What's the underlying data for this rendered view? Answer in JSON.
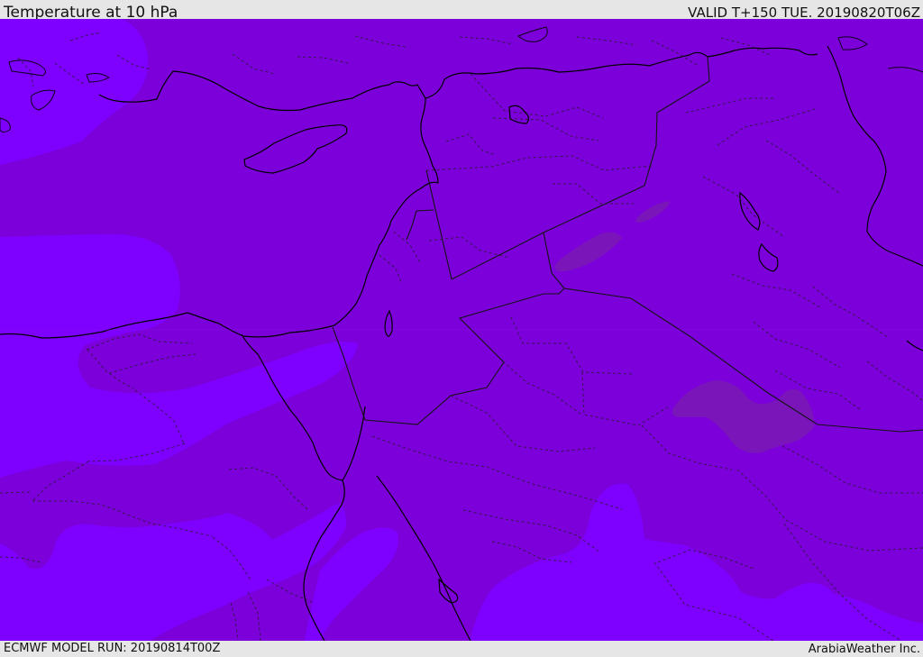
{
  "header": {
    "title": "Temperature at 10 hPa",
    "valid": "VALID T+150 TUE. 20190820T06Z"
  },
  "footer": {
    "model_run": "ECMWF MODEL RUN: 20190814T00Z",
    "provider": "ArabiaWeather Inc."
  },
  "map": {
    "colors": {
      "base_field": "#7c00da",
      "light_field": "#7e00ff",
      "dark_patch": "#7a16b9",
      "coastline": "#000000",
      "border": "#141414"
    }
  }
}
